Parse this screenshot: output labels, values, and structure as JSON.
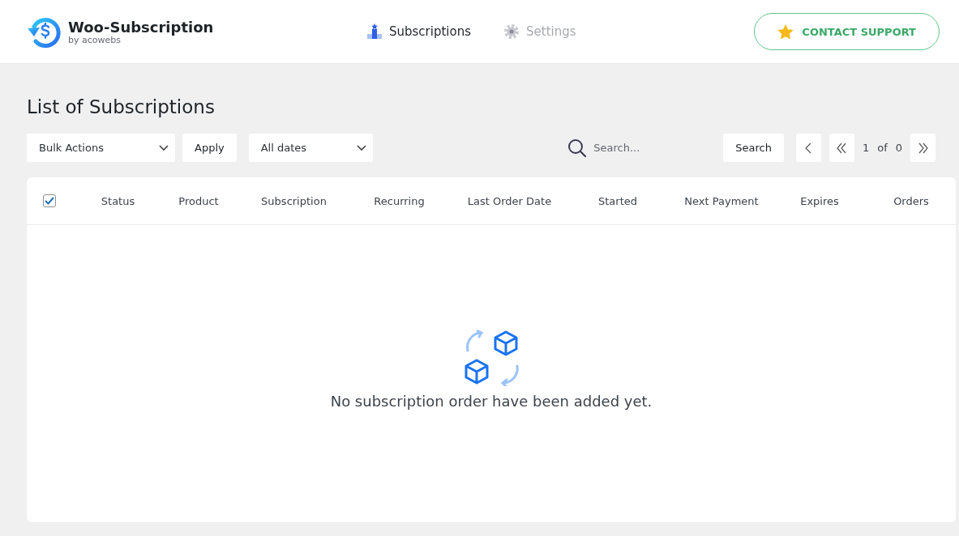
{
  "brand": {
    "title": "Woo-Subscription",
    "subtitle": "by acowebs"
  },
  "tabs": [
    {
      "label": "Subscriptions",
      "selected": true,
      "kind": "list"
    },
    {
      "label": "Settings",
      "selected": false,
      "kind": "gear"
    }
  ],
  "contact_button": "CONTACT SUPPORT",
  "page_title": "List of Subscriptions",
  "toolbar": {
    "bulk_select": "Bulk Actions",
    "apply": "Apply",
    "date_select": "All dates",
    "search": {
      "placeholder": "Search..."
    },
    "search_button": "Search",
    "pagination": {
      "current": "1",
      "of": "of",
      "total": "0"
    }
  },
  "table": {
    "select_all": {
      "checked": true
    },
    "columns": [
      "Status",
      "Product",
      "Subscription",
      "Recurring",
      "Last Order Date",
      "Started",
      "Next Payment",
      "Expires",
      "Orders"
    ],
    "empty_message": "No subscription order have been added yet."
  }
}
